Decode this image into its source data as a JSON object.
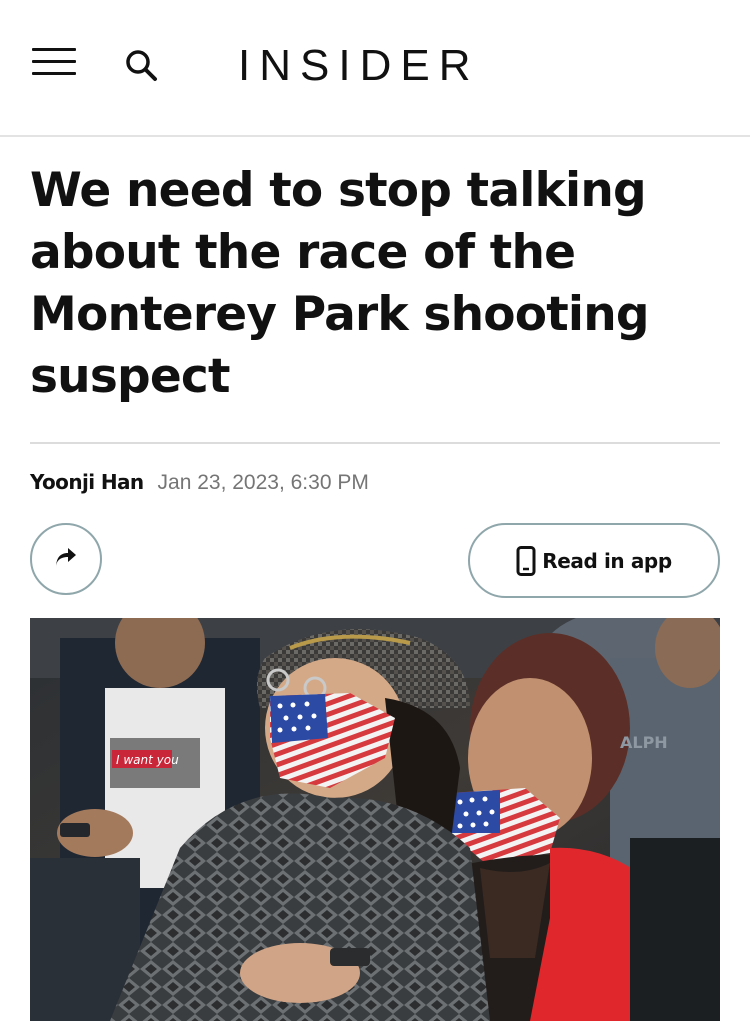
{
  "header": {
    "logo_text": "INSIDER",
    "menu_icon": "hamburger-menu-icon",
    "search_icon": "search-icon"
  },
  "article": {
    "headline": "We need to stop talking about the race of the Monterey Park shooting suspect",
    "author": "Yoonji Han",
    "date": "Jan 23, 2023, 6:30 PM"
  },
  "actions": {
    "share_icon": "share-arrow-icon",
    "read_in_app_label": "Read in app",
    "read_in_app_icon": "smartphone-icon"
  },
  "photo": {
    "shirt_text": "I want you",
    "jacket_text": "ALPH"
  },
  "colors": {
    "text": "#111111",
    "muted": "#757575",
    "button_border": "#8fa6aa",
    "divider": "#dcdcdc"
  }
}
